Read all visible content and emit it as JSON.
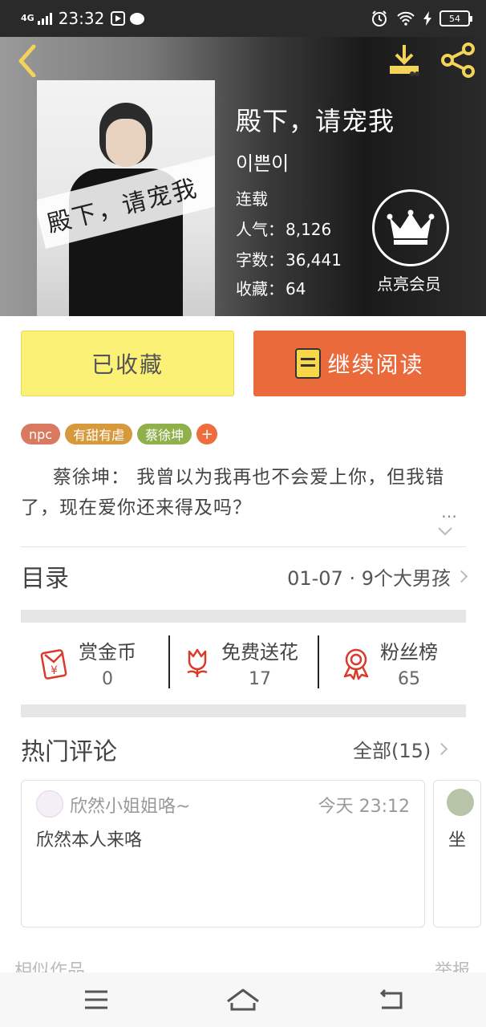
{
  "status_bar": {
    "network": "4G",
    "time": "23:32",
    "battery": "54"
  },
  "book": {
    "cover_title": "殿下，请宠我",
    "title": "殿下，请宠我",
    "author": "이쁜이",
    "status": "连载",
    "popularity_label": "人气：",
    "popularity": "8,126",
    "words_label": "字数：",
    "words": "36,441",
    "favorites_label": "收藏：",
    "favorites": "64",
    "vip_label": "点亮会员"
  },
  "actions": {
    "collected_label": "已收藏",
    "continue_label": "继续阅读"
  },
  "tags": [
    {
      "label": "npc",
      "color": "#d9795f"
    },
    {
      "label": "有甜有虐",
      "color": "#d69a3c"
    },
    {
      "label": "蔡徐坤",
      "color": "#8fb04b"
    }
  ],
  "tag_add": "+",
  "intro": {
    "text": "蔡徐坤：  我曾以为我再也不会爱上你，但我错了，现在爱你还来得及吗？",
    "more": "…"
  },
  "toc": {
    "label": "目录",
    "latest": "01-07 · 9个大男孩"
  },
  "stats": [
    {
      "label": "赏金币",
      "value": "0",
      "icon": "red-envelope-icon"
    },
    {
      "label": "免费送花",
      "value": "17",
      "icon": "flower-icon"
    },
    {
      "label": "粉丝榜",
      "value": "65",
      "icon": "medal-icon"
    }
  ],
  "comments_section": {
    "title": "热门评论",
    "all_label": "全部(15)"
  },
  "comments": [
    {
      "user": "欣然小姐姐咯~",
      "time": "今天 23:12",
      "text": "欣然本人来咯"
    },
    {
      "user": "",
      "time": "",
      "text": "坐"
    }
  ],
  "footer": {
    "similar": "相似作品",
    "report": "举报"
  },
  "colors": {
    "accent_orange": "#eb6a3c",
    "collect_yellow": "#fbf176",
    "icon_red": "#d93a2a",
    "icon_yellow": "#f4d35a"
  }
}
